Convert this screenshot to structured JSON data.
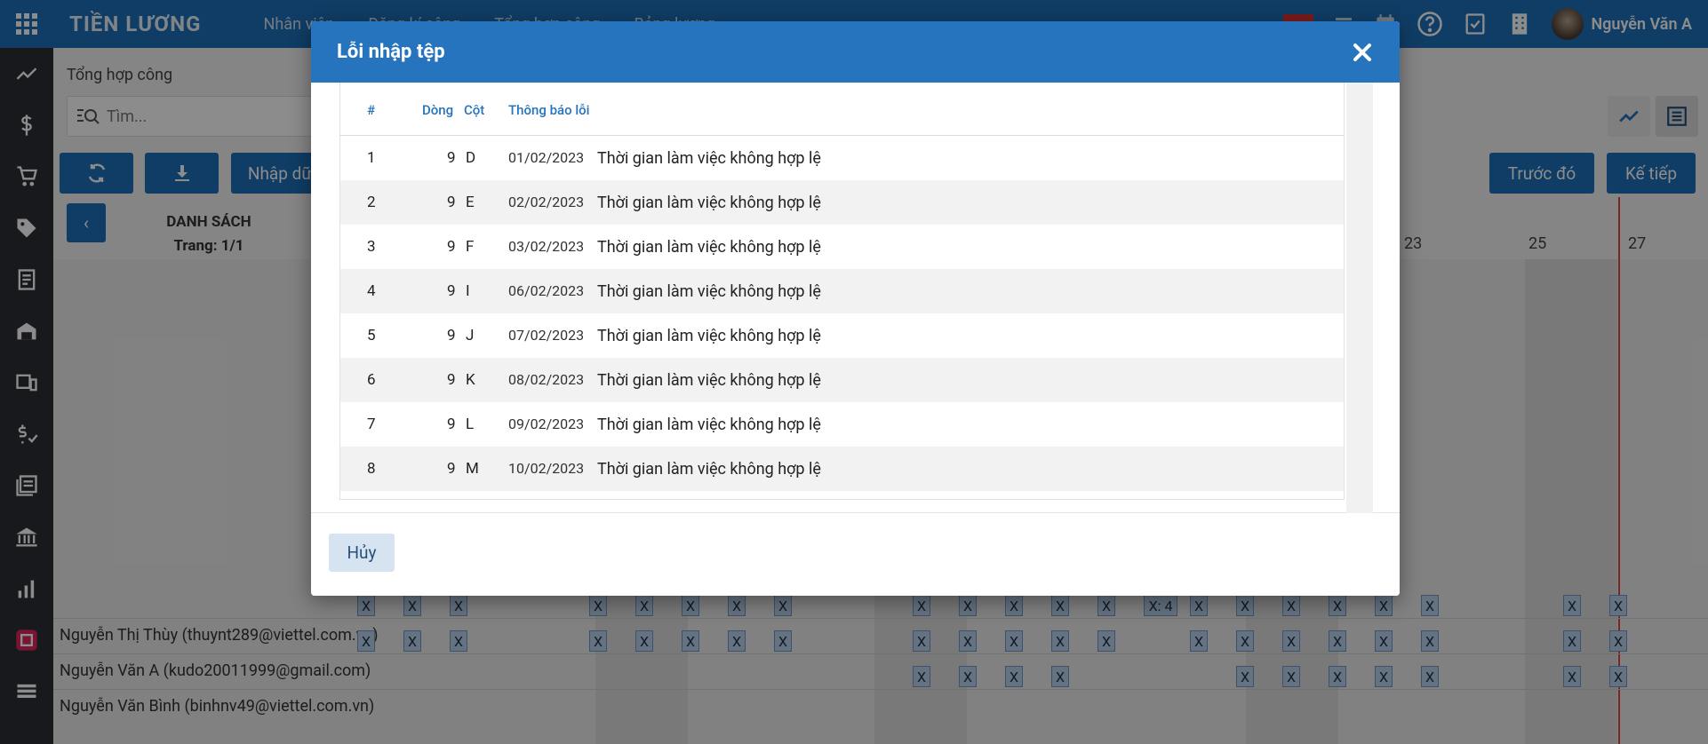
{
  "app": {
    "title": "TIỀN LƯƠNG",
    "nav": [
      "Nhân viên",
      "Đăng kí công",
      "Tổng hợp công",
      "Bảng lương"
    ],
    "user_name": "Nguyễn Văn A"
  },
  "page": {
    "breadcrumb": "Tổng hợp công",
    "search_placeholder": "Tìm...",
    "import_label": "Nhập dữ",
    "prev_label": "Trước đó",
    "next_label": "Kế tiếp",
    "back_label": "‹",
    "list_title": "DANH SÁCH",
    "list_page": "Trang: 1/1",
    "day_numbers": [
      "23",
      "25",
      "27"
    ],
    "employees": [
      "Nguyễn Thị Thùy (thuynt289@viettel.com.vn)",
      "Nguyễn Văn A (kudo20011999@gmail.com)",
      "Nguyễn Văn Bình (binhnv49@viettel.com.vn)"
    ],
    "mark_label": "X",
    "mark_special": "X: 4"
  },
  "modal": {
    "title": "Lỗi nhập tệp",
    "columns": {
      "index": "#",
      "row": "Dòng",
      "col": "Cột",
      "message": "Thông báo lỗi"
    },
    "rows": [
      {
        "index": "1",
        "row": "9",
        "col": "D",
        "date": "01/02/2023",
        "message": "Thời gian làm việc không hợp lệ"
      },
      {
        "index": "2",
        "row": "9",
        "col": "E",
        "date": "02/02/2023",
        "message": "Thời gian làm việc không hợp lệ"
      },
      {
        "index": "3",
        "row": "9",
        "col": "F",
        "date": "03/02/2023",
        "message": "Thời gian làm việc không hợp lệ"
      },
      {
        "index": "4",
        "row": "9",
        "col": "I",
        "date": "06/02/2023",
        "message": "Thời gian làm việc không hợp lệ"
      },
      {
        "index": "5",
        "row": "9",
        "col": "J",
        "date": "07/02/2023",
        "message": "Thời gian làm việc không hợp lệ"
      },
      {
        "index": "6",
        "row": "9",
        "col": "K",
        "date": "08/02/2023",
        "message": "Thời gian làm việc không hợp lệ"
      },
      {
        "index": "7",
        "row": "9",
        "col": "L",
        "date": "09/02/2023",
        "message": "Thời gian làm việc không hợp lệ"
      },
      {
        "index": "8",
        "row": "9",
        "col": "M",
        "date": "10/02/2023",
        "message": "Thời gian làm việc không hợp lệ"
      }
    ],
    "cancel_label": "Hủy"
  },
  "colors": {
    "primary": "#1e6fb8",
    "modal_header": "#2674bd",
    "sidebar": "#2b2f33",
    "mark_fill": "#b8d0ec",
    "today_line": "#e04545"
  }
}
